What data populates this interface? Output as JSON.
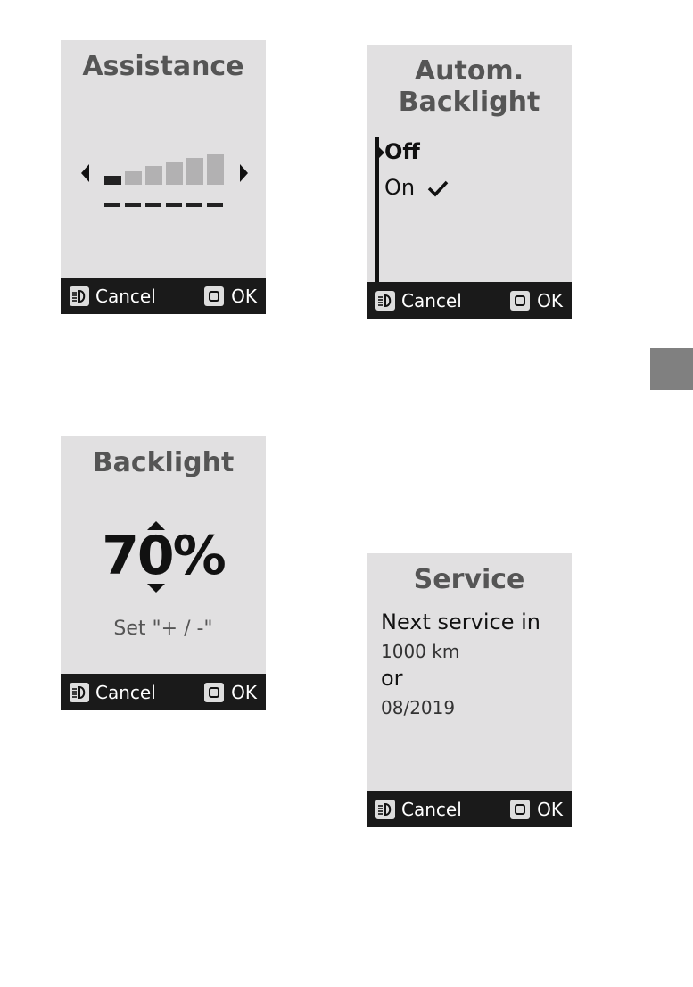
{
  "footer": {
    "cancel_label": "Cancel",
    "ok_label": "OK",
    "cancel_icon": "light-icon",
    "ok_icon": "square-button-icon"
  },
  "assistance": {
    "title": "Assistance",
    "level": 1,
    "levels_total": 6,
    "left_arrow_icon": "arrow-left-icon",
    "right_arrow_icon": "arrow-right-icon"
  },
  "autom_backlight": {
    "title_line1": "Autom.",
    "title_line2": "Backlight",
    "options": [
      {
        "label": "Off",
        "highlighted": true,
        "checked": false
      },
      {
        "label": "On",
        "highlighted": false,
        "checked": true
      }
    ],
    "check_icon": "checkmark-icon"
  },
  "backlight": {
    "title": "Backlight",
    "value": "70%",
    "hint": "Set \"+ / -\""
  },
  "service": {
    "title": "Service",
    "line1": "Next service in",
    "distance": "1000 km",
    "or": "or",
    "date": "08/2019"
  },
  "colors": {
    "screen_bg": "#e1e0e1",
    "footer_bg": "#1a1a1a",
    "title": "#555555",
    "tab": "#808080"
  }
}
